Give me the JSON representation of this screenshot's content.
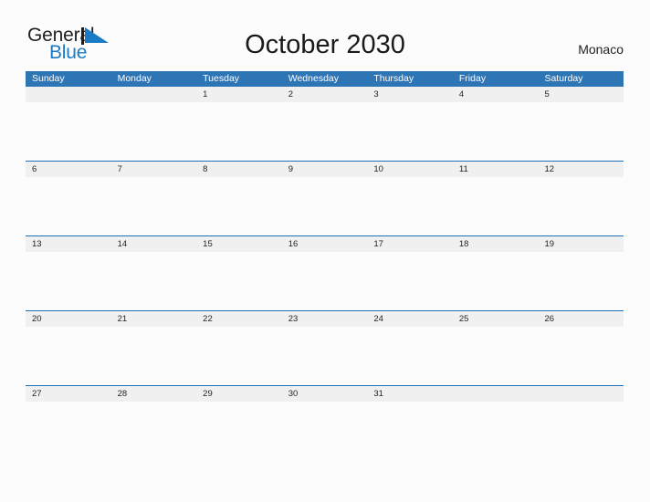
{
  "brand": {
    "word_one": "General",
    "word_two": "Blue",
    "mark_icon": "blue-triangle-flag-icon",
    "color_dark": "#231f20",
    "color_blue": "#1b7bc4"
  },
  "header": {
    "title": "October 2030",
    "region": "Monaco"
  },
  "theme": {
    "header_blue": "#2e75b6",
    "row_divider_blue": "#1f6fb4",
    "date_band_gray": "#f0f0f0",
    "page_background": "#fcfcfc",
    "text_dark": "#231f20",
    "header_text": "#ffffff"
  },
  "calendar": {
    "month": "October",
    "year": "2030",
    "weekday_headers": [
      "Sunday",
      "Monday",
      "Tuesday",
      "Wednesday",
      "Thursday",
      "Friday",
      "Saturday"
    ],
    "weeks": [
      {
        "days": [
          {
            "date": ""
          },
          {
            "date": ""
          },
          {
            "date": "1"
          },
          {
            "date": "2"
          },
          {
            "date": "3"
          },
          {
            "date": "4"
          },
          {
            "date": "5"
          }
        ]
      },
      {
        "days": [
          {
            "date": "6"
          },
          {
            "date": "7"
          },
          {
            "date": "8"
          },
          {
            "date": "9"
          },
          {
            "date": "10"
          },
          {
            "date": "11"
          },
          {
            "date": "12"
          }
        ]
      },
      {
        "days": [
          {
            "date": "13"
          },
          {
            "date": "14"
          },
          {
            "date": "15"
          },
          {
            "date": "16"
          },
          {
            "date": "17"
          },
          {
            "date": "18"
          },
          {
            "date": "19"
          }
        ]
      },
      {
        "days": [
          {
            "date": "20"
          },
          {
            "date": "21"
          },
          {
            "date": "22"
          },
          {
            "date": "23"
          },
          {
            "date": "24"
          },
          {
            "date": "25"
          },
          {
            "date": "26"
          }
        ]
      },
      {
        "days": [
          {
            "date": "27"
          },
          {
            "date": "28"
          },
          {
            "date": "29"
          },
          {
            "date": "30"
          },
          {
            "date": "31"
          },
          {
            "date": ""
          },
          {
            "date": ""
          }
        ]
      }
    ]
  }
}
